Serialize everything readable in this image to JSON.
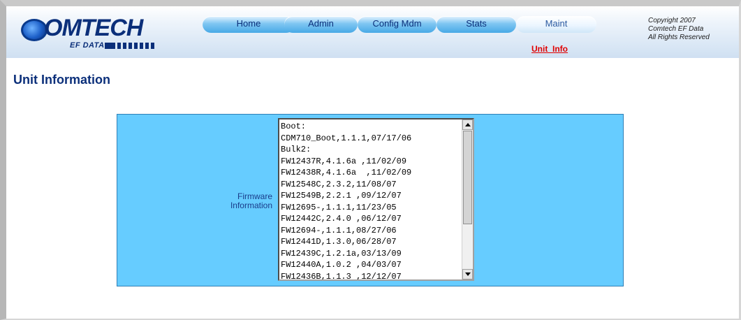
{
  "brand": {
    "name": "OMTECH",
    "subtitle": "EF DATA",
    "logo_color": "#0b2f7a"
  },
  "nav": {
    "tabs": [
      {
        "label": "Home"
      },
      {
        "label": "Admin"
      },
      {
        "label": "Config Mdm"
      },
      {
        "label": "Stats"
      },
      {
        "label": "Maint",
        "active": true
      }
    ],
    "sub_link": "Unit_Info"
  },
  "copyright": {
    "line1": "Copyright 2007",
    "line2": "Comtech EF Data",
    "line3": "All Rights Reserved"
  },
  "page": {
    "title": "Unit Information"
  },
  "firmware": {
    "label_line1": "Firmware",
    "label_line2": "Information",
    "lines": [
      "Boot:",
      "CDM710_Boot,1.1.1,07/17/06",
      "Bulk2:",
      "FW12437R,4.1.6a ,11/02/09",
      "FW12438R,4.1.6a  ,11/02/09",
      "FW12548C,2.3.2,11/08/07",
      "FW12549B,2.2.1 ,09/12/07",
      "FW12695-,1.1.1,11/23/05",
      "FW12442C,2.4.0 ,06/12/07",
      "FW12694-,1.1.1,08/27/06",
      "FW12441D,1.3.0,06/28/07",
      "FW12439C,1.2.1a,03/13/09",
      "FW12440A,1.0.2 ,04/03/07",
      "FW12436B,1.1.3 ,12/12/07"
    ]
  },
  "colors": {
    "panel": "#66ccff",
    "title": "#0b2f7a",
    "link": "#e00000"
  }
}
